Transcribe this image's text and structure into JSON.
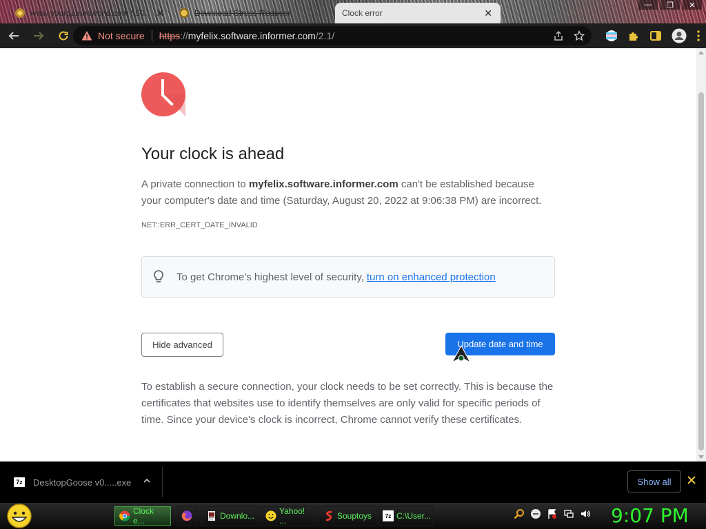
{
  "browser": {
    "tabs": [
      {
        "title": "www.yourgamesworld.com | 50...",
        "icon": "site-favicon"
      },
      {
        "title": "Download Stress Reducer",
        "icon": "site-favicon"
      },
      {
        "title": "Clock error",
        "icon": "none",
        "active": true
      }
    ],
    "address": {
      "security_label": "Not secure",
      "scheme": "https",
      "scheme_sep": "://",
      "host": "myfelix.software.informer.com",
      "path": "/2.1/"
    }
  },
  "page": {
    "heading": "Your clock is ahead",
    "explanation_pre": "A private connection to ",
    "explanation_host": "myfelix.software.informer.com",
    "explanation_post": " can't be established because your computer's date and time (Saturday, August 20, 2022 at 9:06:38 PM) are incorrect.",
    "error_code": "NET::ERR_CERT_DATE_INVALID",
    "protection_text": "To get Chrome's highest level of security,",
    "protection_link": "turn on enhanced protection",
    "hide_advanced_label": "Hide advanced",
    "update_button_label": "Update date and time",
    "details": "To establish a secure connection, your clock needs to be set correctly. This is because the certificates that websites use to identify themselves are only valid for specific periods of time. Since your device's clock is incorrect, Chrome cannot verify these certificates.",
    "accent_color": "#1a73e8",
    "clock_icon_color": "#ee5a5a"
  },
  "downloads": {
    "file_name": "DesktopGoose v0.....exe",
    "show_all_label": "Show all"
  },
  "taskbar": {
    "tasks": [
      {
        "label": "Clock e...",
        "icon": "chrome-icon",
        "active": true
      },
      {
        "label": "",
        "icon": "firefox-icon"
      },
      {
        "label": "Downlo...",
        "icon": "document-icon"
      },
      {
        "label": "Yahoo! ...",
        "icon": "smiley-icon"
      },
      {
        "label": "Souptoys",
        "icon": "souptoys-icon"
      },
      {
        "label": "C:\\User...",
        "icon": "7zip-icon"
      }
    ],
    "time": "9:07 PM",
    "time_color": "#2cf22c"
  }
}
